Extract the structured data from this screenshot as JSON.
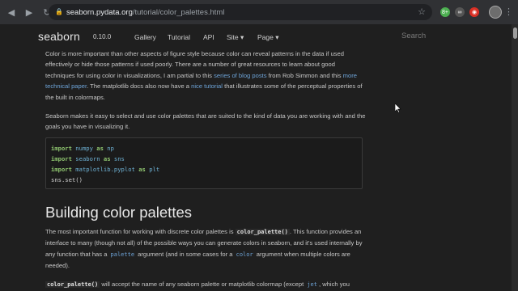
{
  "browser": {
    "url_host": "seaborn.pydata.org",
    "url_path": "/tutorial/color_palettes.html",
    "extensions": [
      {
        "label": "8+",
        "color": "#4caf50"
      },
      {
        "label": "∞",
        "color": "#555555"
      },
      {
        "label": "◉",
        "color": "#d93025"
      }
    ]
  },
  "navbar": {
    "brand": "seaborn",
    "version": "0.10.0",
    "links": [
      "Gallery",
      "Tutorial",
      "API",
      "Site ▾",
      "Page ▾"
    ],
    "search_placeholder": "Search"
  },
  "intro": {
    "p1_a": "Color is more important than other aspects of figure style because color can reveal patterns in the data if used effectively or hide those patterns if used poorly. There are a number of great resources to learn about good techniques for using color in visualizations, I am partial to this ",
    "p1_link1": "series of blog posts",
    "p1_b": " from Rob Simmon and this ",
    "p1_link2": "more technical paper",
    "p1_c": ". The matplotlib docs also now have a ",
    "p1_link3": "nice tutorial",
    "p1_d": " that illustrates some of the perceptual properties of the built in colormaps.",
    "p2": "Seaborn makes it easy to select and use color palettes that are suited to the kind of data you are working with and the goals you have in visualizing it."
  },
  "code": {
    "line1_kw": "import",
    "line1_mod": "numpy",
    "line1_as": "as",
    "line1_alias": "np",
    "line2_kw": "import",
    "line2_mod": "seaborn",
    "line2_as": "as",
    "line2_alias": "sns",
    "line3_kw": "import",
    "line3_mod": "matplotlib.pyplot",
    "line3_as": "as",
    "line3_alias": "plt",
    "line4": "sns.set()"
  },
  "section": {
    "heading": "Building color palettes",
    "p1_a": "The most important function for working with discrete color palettes is ",
    "p1_code1": "color_palette()",
    "p1_b": ". This function provides an interface to many (though not all) of the possible ways you can generate colors in seaborn, and it's used internally by any function that has a ",
    "p1_arg1": "palette",
    "p1_c": " argument (and in some cases for a ",
    "p1_arg2": "color",
    "p1_d": " argument when multiple colors are needed).",
    "p2_code": "color_palette()",
    "p2_a": " will accept the name of any seaborn palette or matplotlib colormap (except ",
    "p2_arg": "jet",
    "p2_b": ", which you"
  }
}
